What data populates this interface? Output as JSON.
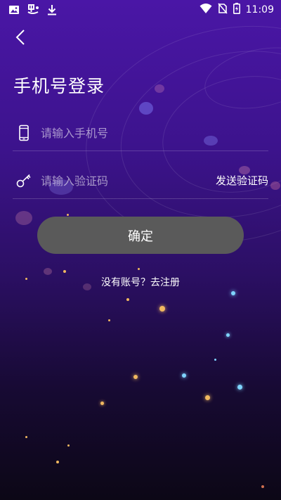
{
  "status_bar": {
    "time": "11:09",
    "icons_left": [
      "image-icon",
      "app-notification-icon",
      "download-icon"
    ],
    "icons_right": [
      "wifi-icon",
      "no-sim-icon",
      "battery-charging-icon"
    ]
  },
  "header": {
    "back_icon": "chevron-left-icon",
    "title": "手机号登录"
  },
  "form": {
    "phone": {
      "icon": "phone-icon",
      "placeholder": "请输入手机号",
      "value": ""
    },
    "code": {
      "icon": "key-icon",
      "placeholder": "请输入验证码",
      "value": "",
      "send_label": "发送验证码"
    },
    "confirm_label": "确定"
  },
  "register": {
    "label": "没有账号？去注册"
  },
  "colors": {
    "background_top": "#4a16a6",
    "background_bottom": "#0c0716",
    "button_bg": "#5a5a5a",
    "text": "#ffffff"
  }
}
